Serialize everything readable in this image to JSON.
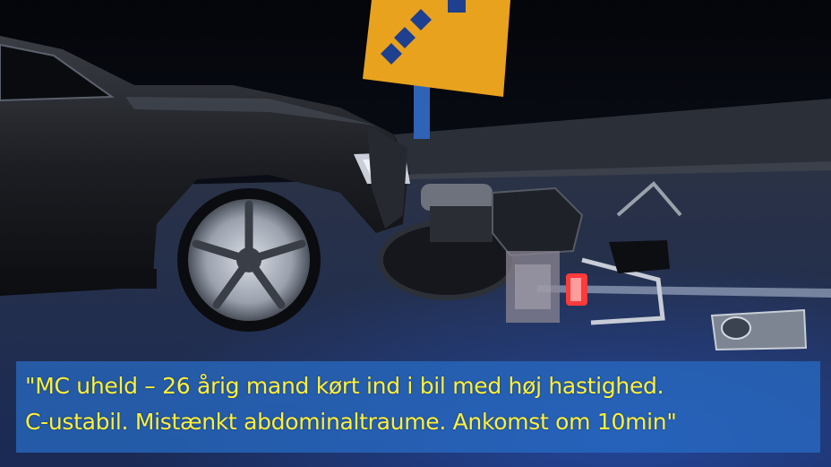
{
  "caption": {
    "line1": "\"MC uheld – 26 årig mand kørt ind i bil med høj hastighed.",
    "line2": "C-ustabil. Mistænkt abdominaltraume. Ankomst om 10min\""
  },
  "colors": {
    "caption_text": "#ffef3a",
    "caption_bg": "#286ec8",
    "sign_yellow": "#e8a21e",
    "sign_blue": "#1f3f8f"
  }
}
